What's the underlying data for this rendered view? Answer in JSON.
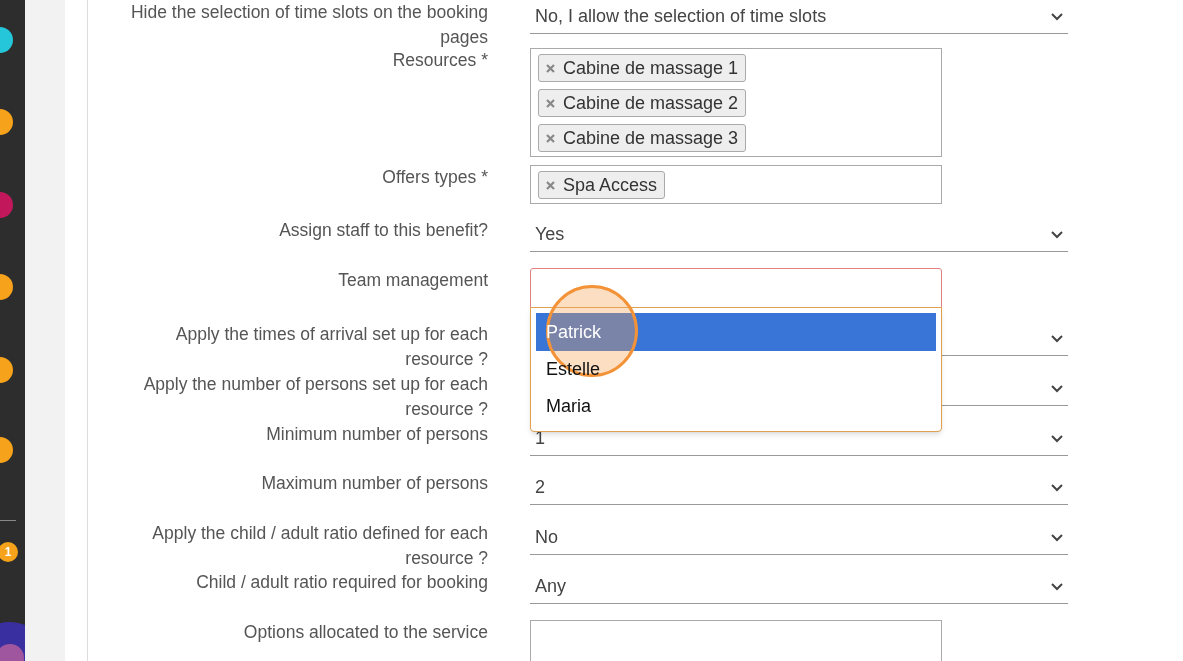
{
  "sidebar": {
    "items": [
      {
        "color": "#26c6da"
      },
      {
        "color": "#f7a21b"
      },
      {
        "color": "#c2185b"
      },
      {
        "color": "#f7a21b"
      },
      {
        "color": "#f7a21b"
      },
      {
        "color": "#f7a21b"
      }
    ],
    "badge": "1"
  },
  "fields": [
    {
      "label": "Hide the selection of time slots on the booking pages",
      "kind": "select",
      "value": "No, I allow the selection of time slots"
    },
    {
      "label": "Resources *",
      "kind": "tags",
      "tags": [
        "Cabine de massage 1",
        "Cabine de massage 2",
        "Cabine de massage 3"
      ]
    },
    {
      "label": "Offers types *",
      "kind": "tags",
      "tags": [
        "Spa Access"
      ]
    },
    {
      "label": "Assign staff to this benefit?",
      "kind": "select",
      "value": "Yes"
    },
    {
      "label": "Team management",
      "kind": "open-list",
      "options": [
        {
          "label": "Patrick",
          "selected": true
        },
        {
          "label": "Estelle",
          "selected": false
        },
        {
          "label": "Maria",
          "selected": false
        }
      ]
    },
    {
      "label": "Apply the times of arrival set up for each resource ?",
      "kind": "select"
    },
    {
      "label": "Apply the number of persons set up for each resource ?",
      "kind": "select"
    },
    {
      "label": "Minimum number of persons",
      "kind": "select",
      "value": "1"
    },
    {
      "label": "Maximum number of persons",
      "kind": "select",
      "value": "2"
    },
    {
      "label": "Apply the child / adult ratio defined for each resource ?",
      "kind": "select",
      "value": "No"
    },
    {
      "label": "Child / adult ratio required for booking",
      "kind": "select",
      "value": "Any"
    },
    {
      "label": "Options allocated to the service",
      "kind": "text-box"
    }
  ]
}
